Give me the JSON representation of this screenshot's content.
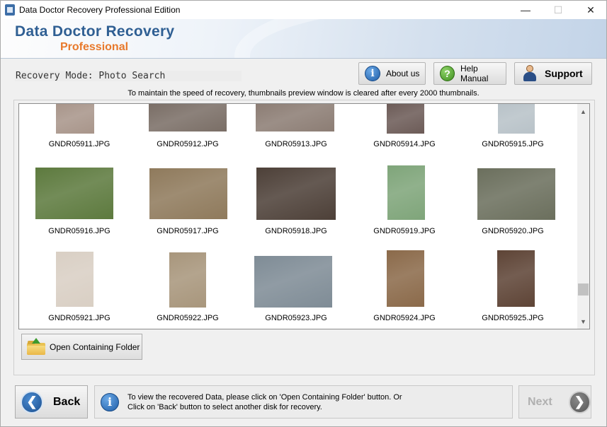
{
  "window": {
    "title": "Data Doctor Recovery Professional Edition",
    "controls": {
      "minimize": "—",
      "maximize": "☐",
      "close": "✕"
    }
  },
  "banner": {
    "title": "Data Doctor Recovery",
    "subtitle": "Professional"
  },
  "mode": {
    "label": "Recovery Mode: Photo Search"
  },
  "toolbar": {
    "about_label": "About us",
    "help_label": "Help Manual",
    "support_label": "Support"
  },
  "notice": "To maintain the speed of recovery, thumbnails preview window is cleared after every 2000 thumbnails.",
  "thumbnails": [
    {
      "name": "GNDR05911.JPG",
      "color": "#a8958a"
    },
    {
      "name": "GNDR05912.JPG",
      "color": "#7a6e66"
    },
    {
      "name": "GNDR05913.JPG",
      "color": "#8c7d74"
    },
    {
      "name": "GNDR05914.JPG",
      "color": "#6c5b57"
    },
    {
      "name": "GNDR05915.JPG",
      "color": "#b8c2c8"
    },
    {
      "name": "GNDR05916.JPG",
      "color": "#5d7a3e"
    },
    {
      "name": "GNDR05917.JPG",
      "color": "#8f7a5c"
    },
    {
      "name": "GNDR05918.JPG",
      "color": "#4d4038"
    },
    {
      "name": "GNDR05919.JPG",
      "color": "#7fa57a"
    },
    {
      "name": "GNDR05920.JPG",
      "color": "#6b6f5d"
    },
    {
      "name": "GNDR05921.JPG",
      "color": "#d9cfc4"
    },
    {
      "name": "GNDR05922.JPG",
      "color": "#a8967c"
    },
    {
      "name": "GNDR05923.JPG",
      "color": "#7f8c96"
    },
    {
      "name": "GNDR05924.JPG",
      "color": "#8b6a4a"
    },
    {
      "name": "GNDR05925.JPG",
      "color": "#5e4436"
    }
  ],
  "actions": {
    "open_folder_label": "Open Containing Folder"
  },
  "footer": {
    "back_label": "Back",
    "next_label": "Next",
    "message_line1": "To view the recovered Data, please click on 'Open Containing Folder' button. Or",
    "message_line2": "Click on 'Back' button to select another disk for recovery."
  }
}
